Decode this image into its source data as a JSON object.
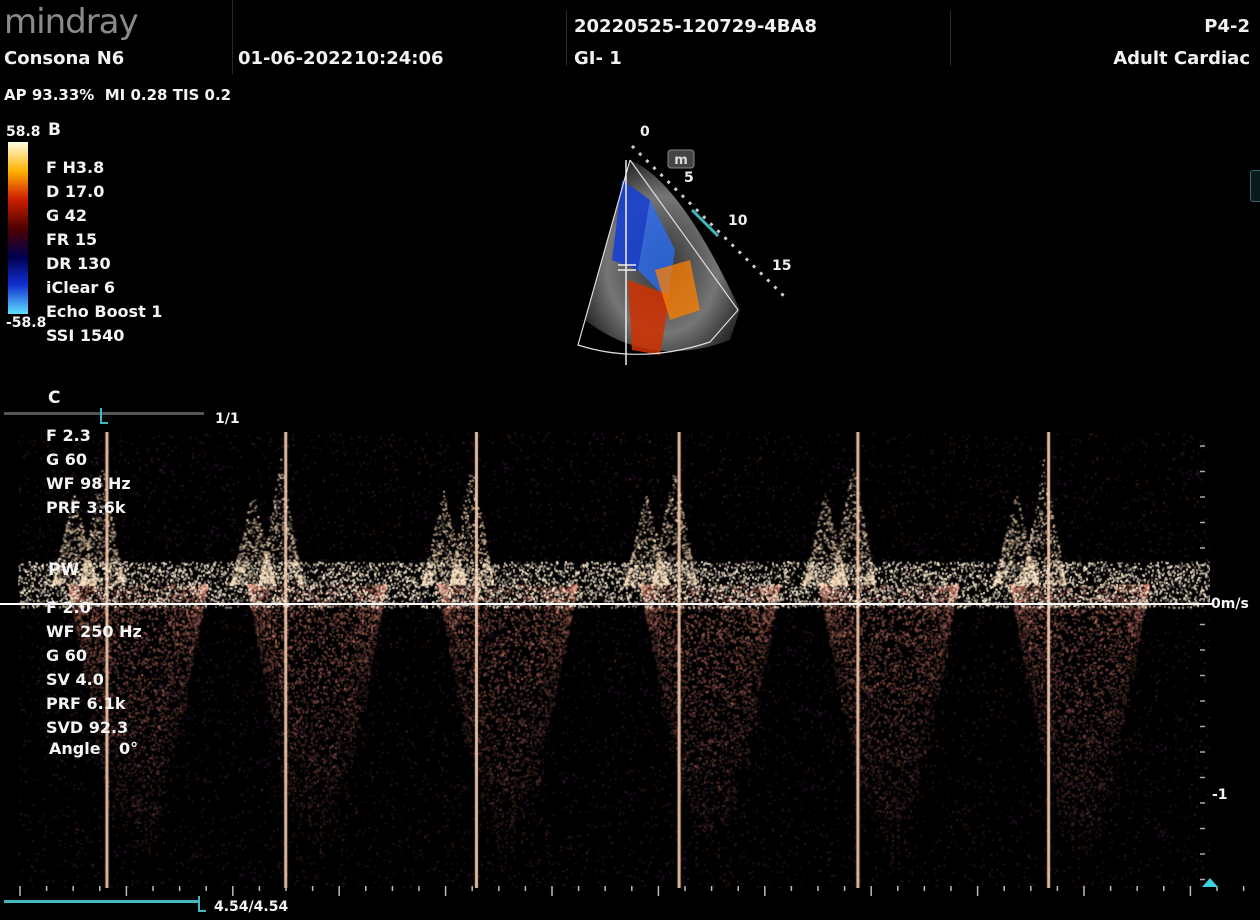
{
  "header": {
    "brand": "mindray",
    "model": "Consona N6",
    "date": "01-06-2022",
    "time": "10:24:06",
    "exam_id": "20220525-120729-4BA8",
    "gi": "GI- 1",
    "probe": "P4-2",
    "preset": "Adult Cardiac",
    "power_line": "AP 93.33%  MI 0.28 TIS 0.2"
  },
  "color_bar": {
    "max": "58.8",
    "min": "-58.8",
    "colors": [
      "#ffffe0",
      "#ffb000",
      "#d02000",
      "#500000",
      "#000050",
      "#1030d0",
      "#60e0ff"
    ]
  },
  "bmode": {
    "label": "B",
    "params": [
      "F H3.8",
      "D 17.0",
      "G 42",
      "FR 15",
      "DR 130",
      "iClear 6",
      "Echo Boost 1",
      "SSI 1540"
    ]
  },
  "depth_scale": {
    "labels": [
      "0",
      "5",
      "10",
      "15"
    ],
    "marker": "m"
  },
  "color_mode": {
    "label": "C",
    "page": "1/1",
    "params": [
      "F 2.3",
      "G 60",
      "WF 98 Hz",
      "PRF 3.6k"
    ]
  },
  "pw_mode": {
    "label": "PW",
    "params": [
      "F 2.0",
      "WF 250 Hz",
      "G 60",
      "SV 4.0",
      "PRF 6.1k",
      "SVD 92.3"
    ],
    "angle_label": "Angle",
    "angle_value": "0°"
  },
  "doppler_scale": {
    "baseline_label": "0m/s",
    "tick_label": "-1"
  },
  "cine": {
    "position": "4.54/4.54",
    "progress": 1.0
  },
  "chart_data": {
    "type": "area",
    "title": "",
    "xlabel": "",
    "ylabel": "",
    "y_unit": "m/s",
    "ylim": [
      -1.5,
      0.75
    ],
    "series": [
      {
        "name": "",
        "beats": [
          0.1,
          0.25,
          0.41,
          0.58,
          0.73,
          0.89
        ],
        "peak_forward": 0.62,
        "peak_reverse": -1.4
      }
    ]
  }
}
